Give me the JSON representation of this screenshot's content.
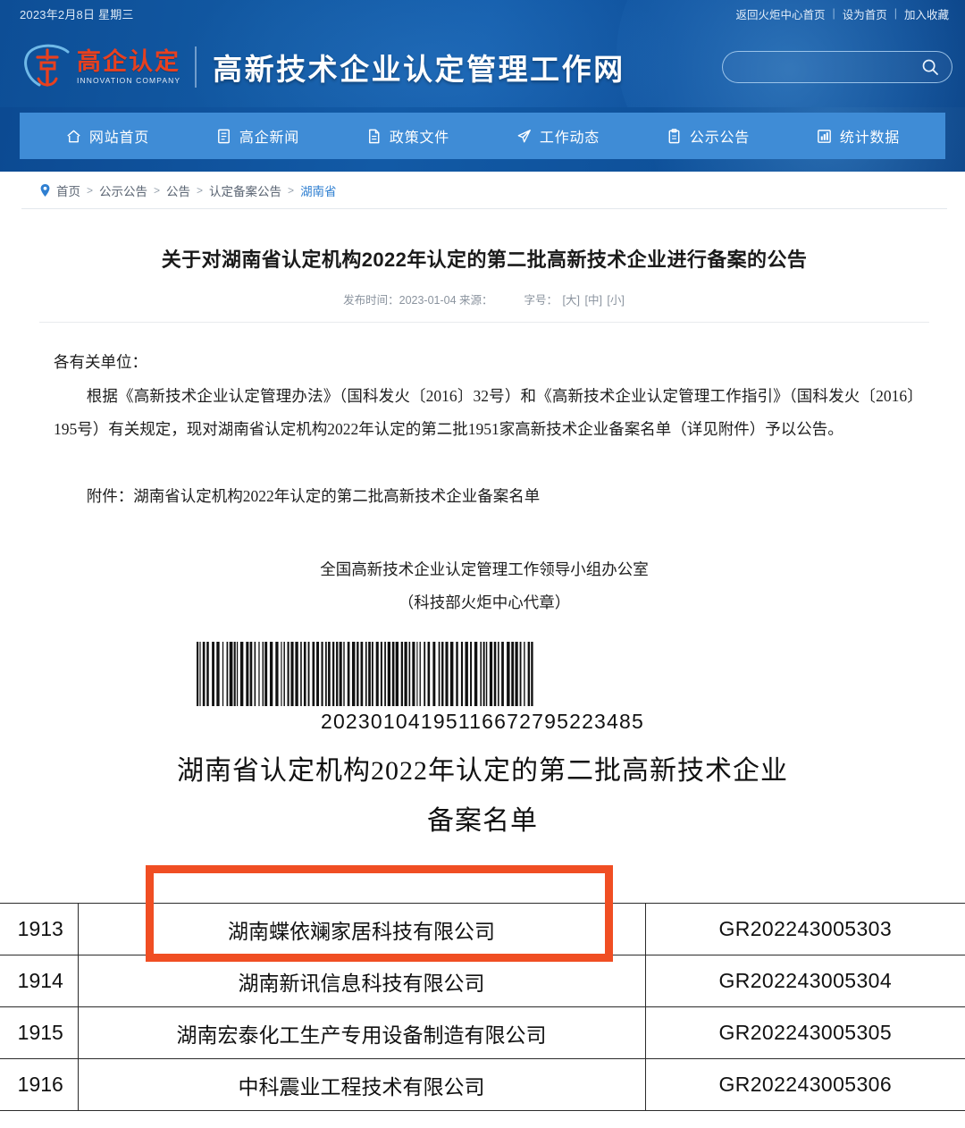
{
  "header": {
    "date": "2023年2月8日 星期三",
    "links": [
      {
        "label": "返回火炬中心首页"
      },
      {
        "label": "设为首页"
      },
      {
        "label": "加入收藏"
      }
    ],
    "separator": "|",
    "logo_cn": "高企认定",
    "logo_en": "INNOVATION COMPANY",
    "site_title": "高新技术企业认定管理工作网",
    "search_placeholder": "",
    "search_value": "",
    "colors": {
      "header_blue": "#14559e",
      "nav_blue": "#3f8cd6",
      "logo_red": "#e8401f",
      "link_blue": "#2f7fd1",
      "highlight_orange": "#f04e23"
    }
  },
  "nav": {
    "items": [
      {
        "label": "网站首页",
        "icon": "home-icon"
      },
      {
        "label": "高企新闻",
        "icon": "news-icon"
      },
      {
        "label": "政策文件",
        "icon": "document-icon"
      },
      {
        "label": "工作动态",
        "icon": "paper-plane-icon"
      },
      {
        "label": "公示公告",
        "icon": "clipboard-icon"
      },
      {
        "label": "统计数据",
        "icon": "chart-icon"
      }
    ]
  },
  "breadcrumb": {
    "pin_icon": "location-pin-icon",
    "items": [
      {
        "label": "首页",
        "active": false
      },
      {
        "label": "公示公告",
        "active": false
      },
      {
        "label": "公告",
        "active": false
      },
      {
        "label": "认定备案公告",
        "active": false
      },
      {
        "label": "湖南省",
        "active": true
      }
    ],
    "arrow": ">"
  },
  "article": {
    "title": "关于对湖南省认定机构2022年认定的第二批高新技术企业进行备案的公告",
    "publish_label": "发布时间：2023-01-04 来源：",
    "fontsize_label": "字号：",
    "fontsize_options": [
      "[大]",
      "[中]",
      "[小]"
    ],
    "salutation": "各有关单位：",
    "paragraph1": "根据《高新技术企业认定管理办法》（国科发火〔2016〕32号）和《高新技术企业认定管理工作指引》（国科发火〔2016〕195号）有关规定，现对湖南省认定机构2022年认定的第二批1951家高新技术企业备案名单（详见附件）予以公告。",
    "attachment": "附件：湖南省认定机构2022年认定的第二批高新技术企业备案名单",
    "signature_org": "全国高新技术企业认定管理工作领导小组办公室",
    "signature_seal": "（科技部火炬中心代章）"
  },
  "attachment_scan": {
    "barcode_number": "20230104195116672795223485",
    "title_line1": "湖南省认定机构2022年认定的第二批高新技术企业",
    "title_line2": "备案名单",
    "table": {
      "rows": [
        {
          "index": "1913",
          "name": "湖南蝶依斓家居科技有限公司",
          "code": "GR202243005303",
          "highlighted": true
        },
        {
          "index": "1914",
          "name": "湖南新讯信息科技有限公司",
          "code": "GR202243005304",
          "highlighted": false
        },
        {
          "index": "1915",
          "name": "湖南宏泰化工生产专用设备制造有限公司",
          "code": "GR202243005305",
          "highlighted": false
        },
        {
          "index": "1916",
          "name": "中科震业工程技术有限公司",
          "code": "GR202243005306",
          "highlighted": false
        }
      ]
    }
  }
}
